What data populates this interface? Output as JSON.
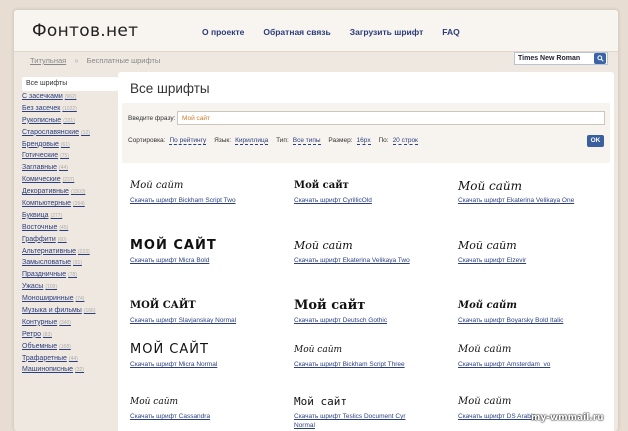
{
  "site": {
    "logo": "Фонтов.нет"
  },
  "nav": [
    {
      "label": "О проекте"
    },
    {
      "label": "Обратная связь"
    },
    {
      "label": "Загрузить шрифт"
    },
    {
      "label": "FAQ"
    }
  ],
  "breadcrumb": {
    "home": "Титульная",
    "separator": "»",
    "current": "Бесплатные шрифты"
  },
  "search": {
    "value": "Times New Roman",
    "button_icon": "search-icon"
  },
  "sidebar": {
    "items": [
      {
        "label": "Все шрифты",
        "count": ""
      },
      {
        "label": "С засечками",
        "count": "(962)"
      },
      {
        "label": "Без засечек",
        "count": "(1022)"
      },
      {
        "label": "Рукописные",
        "count": "(331)"
      },
      {
        "label": "Старославянские",
        "count": "(12)"
      },
      {
        "label": "Брендовые",
        "count": "(61)"
      },
      {
        "label": "Готические",
        "count": "(75)"
      },
      {
        "label": "Заглавные",
        "count": "(44)"
      },
      {
        "label": "Комические",
        "count": "(237)"
      },
      {
        "label": "Декоративные",
        "count": "(1503)"
      },
      {
        "label": "Компьютерные",
        "count": "(264)"
      },
      {
        "label": "Буквица",
        "count": "(277)"
      },
      {
        "label": "Восточные",
        "count": "(45)"
      },
      {
        "label": "Граффити",
        "count": "(60)"
      },
      {
        "label": "Альтернативные",
        "count": "(223)"
      },
      {
        "label": "Замысловатые",
        "count": "(91)"
      },
      {
        "label": "Праздничные",
        "count": "(78)"
      },
      {
        "label": "Ужасы",
        "count": "(109)"
      },
      {
        "label": "Моноширинные",
        "count": "(74)"
      },
      {
        "label": "Музыка и фильмы",
        "count": "(166)"
      },
      {
        "label": "Контурные",
        "count": "(340)"
      },
      {
        "label": "Ретро",
        "count": "(83)"
      },
      {
        "label": "Объемные",
        "count": "(168)"
      },
      {
        "label": "Трафаретные",
        "count": "(44)"
      },
      {
        "label": "Машинописные",
        "count": "(32)"
      }
    ]
  },
  "main": {
    "title": "Все шрифты",
    "phrase_label": "Введите фразу:",
    "phrase_value": "Мой сайт",
    "sort_label": "Сортировка:",
    "sort_value": "По рейтингу",
    "lang_label": "Язык:",
    "lang_value": "Кириллица",
    "type_label": "Тип:",
    "type_value": "Все типы",
    "size_label": "Размер:",
    "size_value": "16px",
    "per_label": "По:",
    "per_value": "20 строк",
    "ok_label": "OK"
  },
  "fonts": [
    {
      "preview": "Мой сайт",
      "link": "Скачать шрифт Bickham Script Two"
    },
    {
      "preview": "Мой сайт",
      "link": "Скачать шрифт CyrillicOld"
    },
    {
      "preview": "Мой сайт",
      "link": "Скачать шрифт Ekaterina Velikaya One"
    },
    {
      "preview": "МОЙ САЙТ",
      "link": "Скачать шрифт Micra Bold"
    },
    {
      "preview": "Мой сайт",
      "link": "Скачать шрифт Ekaterina Velikaya Two"
    },
    {
      "preview": "Мой сайт",
      "link": "Скачать шрифт Elzevir"
    },
    {
      "preview": "МОЙ САЙТ",
      "link": "Скачать шрифт Slavjanskay Normal"
    },
    {
      "preview": "Мой сайт",
      "link": "Скачать шрифт Deutsch Gothic"
    },
    {
      "preview": "Мой сайт",
      "link": "Скачать шрифт Boyarsky Bold Italic"
    },
    {
      "preview": "МОЙ САЙТ",
      "link": "Скачать шрифт Micra Normal"
    },
    {
      "preview": "Мой сайт",
      "link": "Скачать шрифт Bickham Script Three"
    },
    {
      "preview": "Мой сайт",
      "link": "Скачать шрифт Amsterdam_vo"
    },
    {
      "preview": "Мой сайт",
      "link": "Скачать шрифт Cassandra"
    },
    {
      "preview": "Мой сайт",
      "link": "Скачать шрифт Teslics Document Cyr Normal"
    },
    {
      "preview": "Мой сайт",
      "link": "Скачать шрифт DS Arabic"
    }
  ],
  "watermark": "my-wmmail.ru"
}
